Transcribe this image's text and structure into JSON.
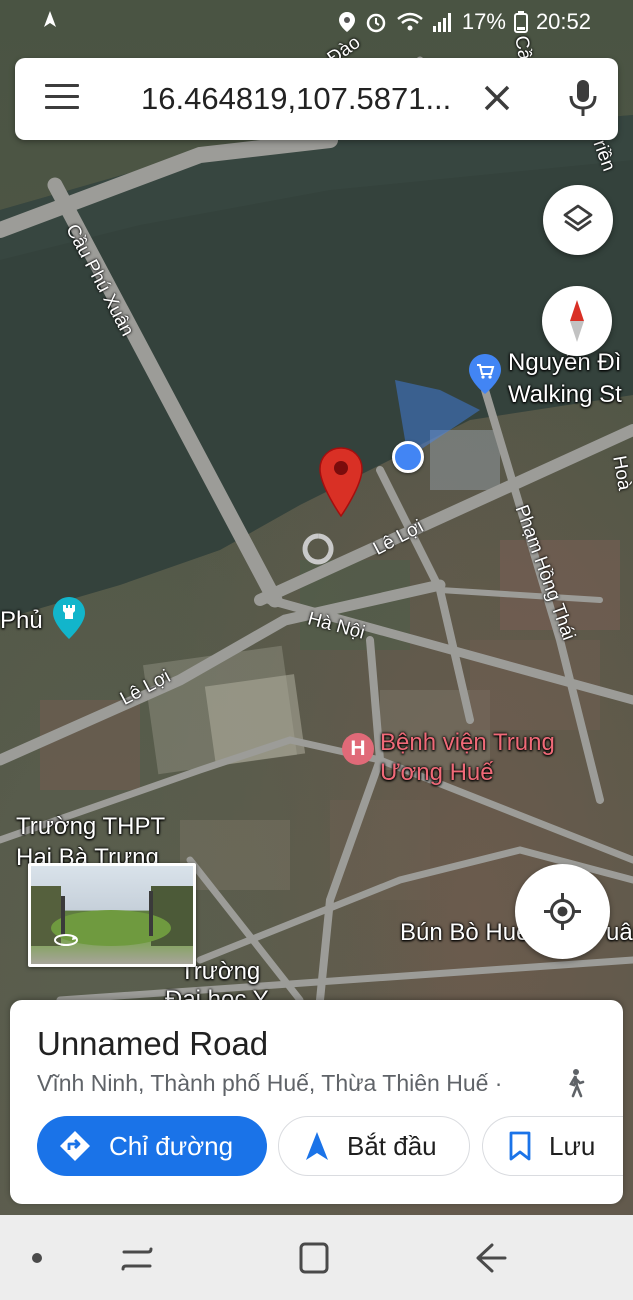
{
  "status_bar": {
    "battery": "17%",
    "time": "20:52"
  },
  "search": {
    "query": "16.464819,107.5871..."
  },
  "map": {
    "labels": {
      "bridge": "Cầu Phú Xuân",
      "street_le_loi_1": "Lê Lợi",
      "street_le_loi_2": "Lê Lợi",
      "street_ha_noi": "Hà Nội",
      "street_pham_hong_thai": "Phạm Hồng Thái",
      "poi_walking_street_1": "Nguyễn Đì",
      "poi_walking_street_2": "Walking St",
      "poi_hospital_1": "Bệnh viện Trung",
      "poi_hospital_2": "Ương Huế",
      "poi_school_1": "Trường THPT",
      "poi_school_2": "Hai Bà Trưng",
      "poi_university_1": "Trường",
      "poi_university_2": "Đại học Y",
      "poi_restaurant": "Bún Bò Huế",
      "poi_restaurant_tail": "uân",
      "poi_phu": "Phủ",
      "top_road": "Đào",
      "top_right": "Cầu",
      "top_right_2": "riền",
      "right_edge": "Hoà"
    },
    "hospital_marker": "H"
  },
  "place": {
    "title": "Unnamed Road",
    "address": "Vĩnh Ninh, Thành phố Huế, Thừa Thiên Huế ·"
  },
  "actions": {
    "directions": "Chỉ đường",
    "start": "Bắt đầu",
    "save": "Lưu"
  },
  "colors": {
    "primary": "#1a73e8",
    "pin": "#d93025",
    "location_dot": "#4285f4"
  }
}
